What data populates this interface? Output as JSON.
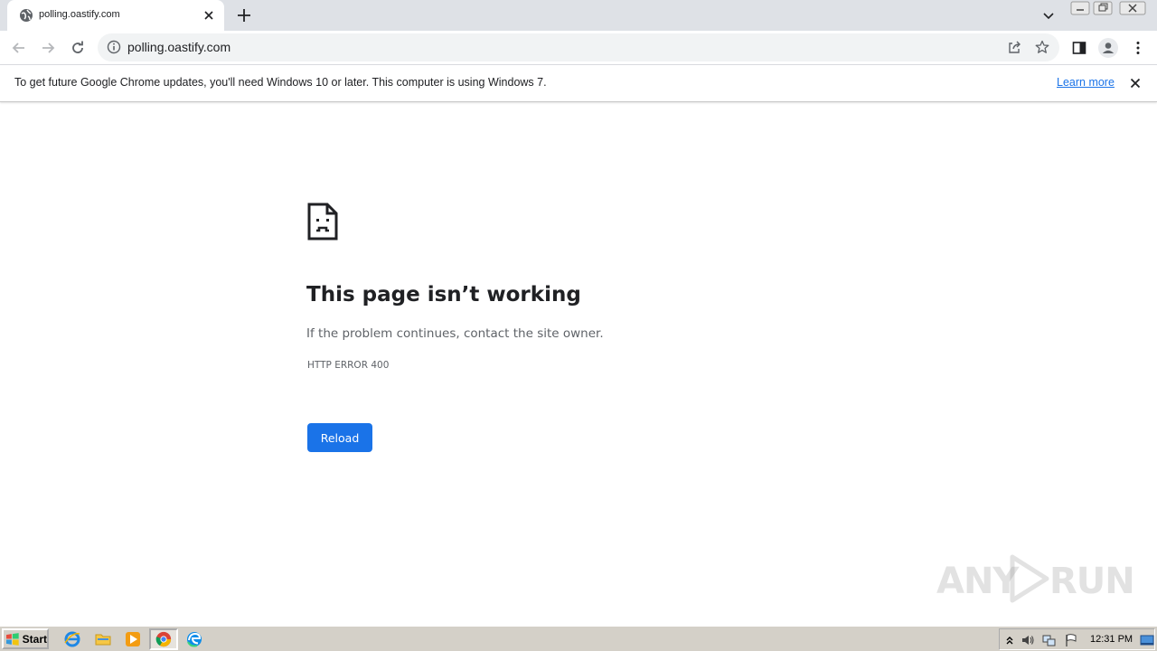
{
  "browser": {
    "tab": {
      "title": "polling.oastify.com"
    },
    "omnibox": {
      "url": "polling.oastify.com"
    }
  },
  "infobar": {
    "message": "To get future Google Chrome updates, you'll need Windows 10 or later. This computer is using Windows 7.",
    "learn_more": "Learn more"
  },
  "error_page": {
    "title": "This page isn’t working",
    "subtitle": "If the problem continues, contact the site owner.",
    "code": "HTTP ERROR 400",
    "reload_label": "Reload"
  },
  "watermark": {
    "text_left": "ANY",
    "text_right": "RUN"
  },
  "taskbar": {
    "start_label": "Start",
    "clock": "12:31 PM"
  },
  "colors": {
    "accent": "#1a73e8",
    "tabstrip": "#dee1e6",
    "omnibox": "#f1f3f4",
    "taskbar": "#d4d0c8"
  },
  "icons": {
    "tab_favicon": "globe-icon",
    "tab_close": "close-icon",
    "new_tab": "plus-icon",
    "back": "arrow-left-icon",
    "forward": "arrow-right-icon",
    "reload": "reload-icon",
    "site_info": "info-icon",
    "share": "share-icon",
    "bookmark": "star-icon",
    "side_panel": "side-panel-icon",
    "profile": "profile-icon",
    "menu": "kebab-menu-icon",
    "error": "sad-document-icon"
  }
}
